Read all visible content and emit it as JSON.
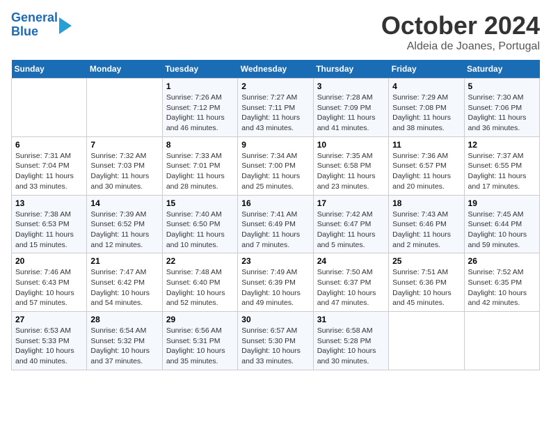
{
  "header": {
    "logo_line1": "General",
    "logo_line2": "Blue",
    "month": "October 2024",
    "location": "Aldeia de Joanes, Portugal"
  },
  "weekdays": [
    "Sunday",
    "Monday",
    "Tuesday",
    "Wednesday",
    "Thursday",
    "Friday",
    "Saturday"
  ],
  "weeks": [
    [
      {
        "day": "",
        "info": ""
      },
      {
        "day": "",
        "info": ""
      },
      {
        "day": "1",
        "info": "Sunrise: 7:26 AM\nSunset: 7:12 PM\nDaylight: 11 hours and 46 minutes."
      },
      {
        "day": "2",
        "info": "Sunrise: 7:27 AM\nSunset: 7:11 PM\nDaylight: 11 hours and 43 minutes."
      },
      {
        "day": "3",
        "info": "Sunrise: 7:28 AM\nSunset: 7:09 PM\nDaylight: 11 hours and 41 minutes."
      },
      {
        "day": "4",
        "info": "Sunrise: 7:29 AM\nSunset: 7:08 PM\nDaylight: 11 hours and 38 minutes."
      },
      {
        "day": "5",
        "info": "Sunrise: 7:30 AM\nSunset: 7:06 PM\nDaylight: 11 hours and 36 minutes."
      }
    ],
    [
      {
        "day": "6",
        "info": "Sunrise: 7:31 AM\nSunset: 7:04 PM\nDaylight: 11 hours and 33 minutes."
      },
      {
        "day": "7",
        "info": "Sunrise: 7:32 AM\nSunset: 7:03 PM\nDaylight: 11 hours and 30 minutes."
      },
      {
        "day": "8",
        "info": "Sunrise: 7:33 AM\nSunset: 7:01 PM\nDaylight: 11 hours and 28 minutes."
      },
      {
        "day": "9",
        "info": "Sunrise: 7:34 AM\nSunset: 7:00 PM\nDaylight: 11 hours and 25 minutes."
      },
      {
        "day": "10",
        "info": "Sunrise: 7:35 AM\nSunset: 6:58 PM\nDaylight: 11 hours and 23 minutes."
      },
      {
        "day": "11",
        "info": "Sunrise: 7:36 AM\nSunset: 6:57 PM\nDaylight: 11 hours and 20 minutes."
      },
      {
        "day": "12",
        "info": "Sunrise: 7:37 AM\nSunset: 6:55 PM\nDaylight: 11 hours and 17 minutes."
      }
    ],
    [
      {
        "day": "13",
        "info": "Sunrise: 7:38 AM\nSunset: 6:53 PM\nDaylight: 11 hours and 15 minutes."
      },
      {
        "day": "14",
        "info": "Sunrise: 7:39 AM\nSunset: 6:52 PM\nDaylight: 11 hours and 12 minutes."
      },
      {
        "day": "15",
        "info": "Sunrise: 7:40 AM\nSunset: 6:50 PM\nDaylight: 11 hours and 10 minutes."
      },
      {
        "day": "16",
        "info": "Sunrise: 7:41 AM\nSunset: 6:49 PM\nDaylight: 11 hours and 7 minutes."
      },
      {
        "day": "17",
        "info": "Sunrise: 7:42 AM\nSunset: 6:47 PM\nDaylight: 11 hours and 5 minutes."
      },
      {
        "day": "18",
        "info": "Sunrise: 7:43 AM\nSunset: 6:46 PM\nDaylight: 11 hours and 2 minutes."
      },
      {
        "day": "19",
        "info": "Sunrise: 7:45 AM\nSunset: 6:44 PM\nDaylight: 10 hours and 59 minutes."
      }
    ],
    [
      {
        "day": "20",
        "info": "Sunrise: 7:46 AM\nSunset: 6:43 PM\nDaylight: 10 hours and 57 minutes."
      },
      {
        "day": "21",
        "info": "Sunrise: 7:47 AM\nSunset: 6:42 PM\nDaylight: 10 hours and 54 minutes."
      },
      {
        "day": "22",
        "info": "Sunrise: 7:48 AM\nSunset: 6:40 PM\nDaylight: 10 hours and 52 minutes."
      },
      {
        "day": "23",
        "info": "Sunrise: 7:49 AM\nSunset: 6:39 PM\nDaylight: 10 hours and 49 minutes."
      },
      {
        "day": "24",
        "info": "Sunrise: 7:50 AM\nSunset: 6:37 PM\nDaylight: 10 hours and 47 minutes."
      },
      {
        "day": "25",
        "info": "Sunrise: 7:51 AM\nSunset: 6:36 PM\nDaylight: 10 hours and 45 minutes."
      },
      {
        "day": "26",
        "info": "Sunrise: 7:52 AM\nSunset: 6:35 PM\nDaylight: 10 hours and 42 minutes."
      }
    ],
    [
      {
        "day": "27",
        "info": "Sunrise: 6:53 AM\nSunset: 5:33 PM\nDaylight: 10 hours and 40 minutes."
      },
      {
        "day": "28",
        "info": "Sunrise: 6:54 AM\nSunset: 5:32 PM\nDaylight: 10 hours and 37 minutes."
      },
      {
        "day": "29",
        "info": "Sunrise: 6:56 AM\nSunset: 5:31 PM\nDaylight: 10 hours and 35 minutes."
      },
      {
        "day": "30",
        "info": "Sunrise: 6:57 AM\nSunset: 5:30 PM\nDaylight: 10 hours and 33 minutes."
      },
      {
        "day": "31",
        "info": "Sunrise: 6:58 AM\nSunset: 5:28 PM\nDaylight: 10 hours and 30 minutes."
      },
      {
        "day": "",
        "info": ""
      },
      {
        "day": "",
        "info": ""
      }
    ]
  ]
}
